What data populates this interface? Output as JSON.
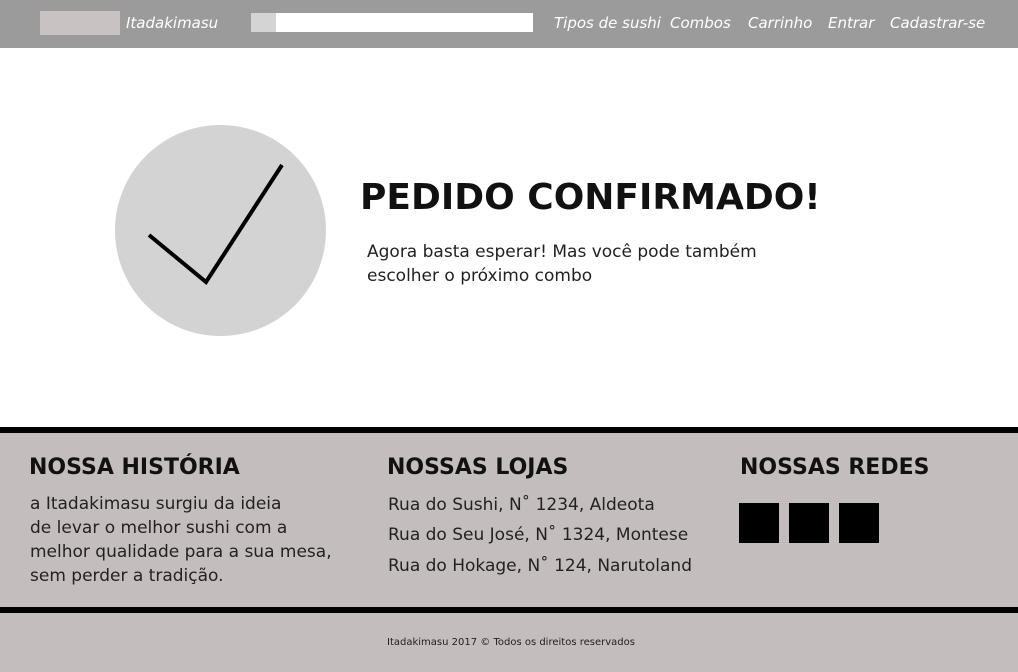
{
  "nav": {
    "brand": "Itadakimasu",
    "search_placeholder": "",
    "links": [
      "Tipos de sushi",
      "Combos",
      "Carrinho",
      "Entrar",
      "Cadastrar-se"
    ]
  },
  "confirmation": {
    "title": "PEDIDO CONFIRMADO!",
    "message_line1": "Agora basta esperar! Mas você pode também",
    "message_line2": "escolher o próximo combo"
  },
  "footer": {
    "history": {
      "heading": "NOSSA HISTÓRIA",
      "lines": [
        "a Itadakimasu surgiu da ideia",
        "de levar o melhor sushi com a",
        "melhor qualidade para a sua mesa,",
        "sem perder a tradição."
      ]
    },
    "stores": {
      "heading": "NOSSAS LOJAS",
      "items": [
        "Rua do Sushi, N˚ 1234, Aldeota",
        "Rua do Seu José, N˚ 1324, Montese",
        "Rua do Hokage, N˚ 124, Narutoland"
      ]
    },
    "social": {
      "heading": "NOSSAS REDES",
      "icons": [
        "social-icon-1",
        "social-icon-2",
        "social-icon-3"
      ]
    },
    "copyright": "Itadakimasu 2017  © Todos os direitos reservados"
  },
  "colors": {
    "nav_bg": "#9b9b9b",
    "footer_bg": "#c4bdbd",
    "check_circle": "#d3d3d3"
  }
}
